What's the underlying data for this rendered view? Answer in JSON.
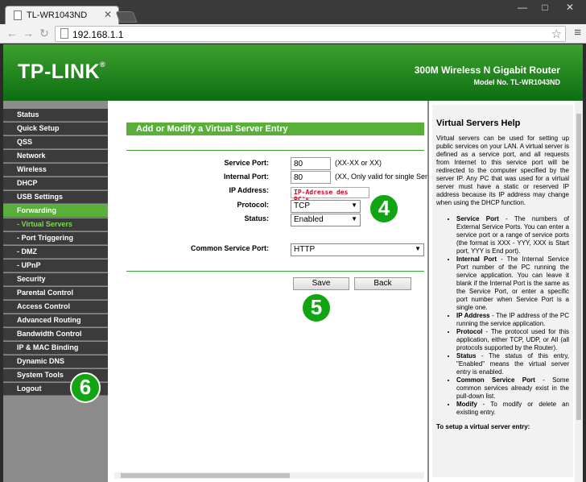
{
  "browser": {
    "tab_title": "TL-WR1043ND",
    "url": "192.168.1.1",
    "window_buttons": [
      "—",
      "□",
      "✕"
    ]
  },
  "header": {
    "logo": "TP-LINK",
    "logo_mark": "®",
    "model_title": "300M Wireless N Gigabit Router",
    "model_no": "Model No. TL-WR1043ND"
  },
  "sidebar": {
    "items": [
      {
        "label": "Status"
      },
      {
        "label": "Quick Setup"
      },
      {
        "label": "QSS"
      },
      {
        "label": "Network"
      },
      {
        "label": "Wireless"
      },
      {
        "label": "DHCP"
      },
      {
        "label": "USB Settings"
      },
      {
        "label": "Forwarding"
      },
      {
        "label": "- Virtual Servers"
      },
      {
        "label": "- Port Triggering"
      },
      {
        "label": "- DMZ"
      },
      {
        "label": "- UPnP"
      },
      {
        "label": "Security"
      },
      {
        "label": "Parental Control"
      },
      {
        "label": "Access Control"
      },
      {
        "label": "Advanced Routing"
      },
      {
        "label": "Bandwidth Control"
      },
      {
        "label": "IP & MAC Binding"
      },
      {
        "label": "Dynamic DNS"
      },
      {
        "label": "System Tools"
      },
      {
        "label": "Logout"
      }
    ]
  },
  "form": {
    "title": "Add or Modify a Virtual Server Entry",
    "service_port_label": "Service Port:",
    "service_port_value": "80",
    "service_port_hint": "(XX-XX or XX)",
    "internal_port_label": "Internal Port:",
    "internal_port_value": "80",
    "internal_port_hint": "(XX, Only valid for single Serv",
    "ip_label": "IP Address:",
    "ip_value": "IP-Adresse des PC's",
    "protocol_label": "Protocol:",
    "protocol_value": "TCP",
    "status_label": "Status:",
    "status_value": "Enabled",
    "common_label": "Common Service Port:",
    "common_value": "HTTP",
    "save": "Save",
    "back": "Back"
  },
  "badges": {
    "b4": "4",
    "b5": "5",
    "b6": "6"
  },
  "help": {
    "title": "Virtual Servers Help",
    "intro": "Virtual servers can be used for setting up public services on your LAN. A virtual server is defined as a service port, and all requests from Internet to this service port will be redirected to the computer specified by the server IP. Any PC that was used for a virtual server must have a static or reserved IP address because its IP address may change when using the DHCP function.",
    "items": [
      {
        "term": "Service Port",
        "text": " - The numbers of External Service Ports. You can enter a service port or a range of service ports (the format is XXX - YYY, XXX is Start port, YYY is End port)."
      },
      {
        "term": "Internal Port",
        "text": " - The Internal Service Port number of the PC running the service application. You can leave it blank if the Internal Port is the same as the Service Port, or enter a specific port number when Service Port is a single one."
      },
      {
        "term": "IP Address",
        "text": " - The IP address of the PC running the service application."
      },
      {
        "term": "Protocol",
        "text": " - The protocol used for this application, either TCP, UDP, or All (all protocols supported by the Router)."
      },
      {
        "term": "Status",
        "text": " - The status of this entry, \"Enabled\" means the virtual server entry is enabled."
      },
      {
        "term": "Common Service Port",
        "text": " - Some common services already exist in the pull-down list."
      },
      {
        "term": "Modify",
        "text": " - To modify or delete an existing entry."
      }
    ],
    "setup": "To setup a virtual server entry:"
  },
  "colors": {
    "accent": "#58b03a",
    "header_dark": "#0d6e12",
    "sidebar": "#3b3b3b",
    "badge": "#11a511",
    "ip_text": "#e0001b"
  }
}
